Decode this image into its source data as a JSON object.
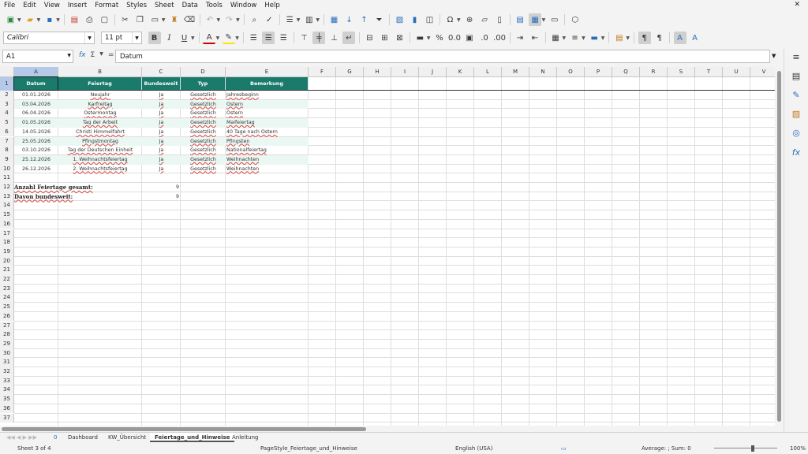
{
  "menu": [
    "File",
    "Edit",
    "View",
    "Insert",
    "Format",
    "Styles",
    "Sheet",
    "Data",
    "Tools",
    "Window",
    "Help"
  ],
  "close_glyph": "✕",
  "font": {
    "name": "Calibri",
    "size": "11 pt"
  },
  "formula": {
    "cell_ref": "A1",
    "content": "Datum",
    "sum_glyph": "Σ",
    "fx_glyph": "fx",
    "eq_glyph": "="
  },
  "columns": [
    "A",
    "B",
    "C",
    "D",
    "E",
    "F",
    "G",
    "H",
    "I",
    "J",
    "K",
    "L",
    "M",
    "N",
    "O",
    "P",
    "Q",
    "R",
    "S",
    "T",
    "U",
    "V"
  ],
  "rows": [
    "1",
    "2",
    "3",
    "4",
    "5",
    "6",
    "7",
    "8",
    "9",
    "10",
    "11",
    "12",
    "13",
    "14",
    "15",
    "16",
    "17",
    "18",
    "19",
    "20",
    "21",
    "22",
    "23",
    "24",
    "25",
    "26",
    "27",
    "28",
    "29",
    "30",
    "31",
    "32",
    "33",
    "34",
    "35",
    "36",
    "37"
  ],
  "table": {
    "headers": [
      "Datum",
      "Feiertag",
      "Bundesweit",
      "Typ",
      "Bemerkung"
    ],
    "rows": [
      [
        "01.01.2026",
        "Neujahr",
        "Ja",
        "Gesetzlich",
        "Jahresbeginn"
      ],
      [
        "03.04.2026",
        "Karfreitag",
        "Ja",
        "Gesetzlich",
        "Ostern"
      ],
      [
        "06.04.2026",
        "Ostermontag",
        "Ja",
        "Gesetzlich",
        "Ostern"
      ],
      [
        "01.05.2026",
        "Tag der Arbeit",
        "Ja",
        "Gesetzlich",
        "Maifeiertag"
      ],
      [
        "14.05.2026",
        "Christi Himmelfahrt",
        "Ja",
        "Gesetzlich",
        "40 Tage nach Ostern"
      ],
      [
        "25.05.2026",
        "Pfingstmontag",
        "Ja",
        "Gesetzlich",
        "Pfingsten"
      ],
      [
        "03.10.2026",
        "Tag der Deutschen Einheit",
        "Ja",
        "Gesetzlich",
        "Nationalfeiertag"
      ],
      [
        "25.12.2026",
        "1. Weihnachtsfeiertag",
        "Ja",
        "Gesetzlich",
        "Weihnachten"
      ],
      [
        "26.12.2026",
        "2. Weihnachtsfeiertag",
        "Ja",
        "Gesetzlich",
        "Weihnachten"
      ]
    ]
  },
  "summary": [
    {
      "label": "Anzahl Feiertage gesamt:",
      "value": "9"
    },
    {
      "label": "Davon bundesweit:",
      "value": "9"
    }
  ],
  "sheet_tabs": [
    "Dashboard",
    "KW_Übersicht",
    "Feiertage_und_Hinweise",
    "Anleitung"
  ],
  "active_tab": "Feiertage_und_Hinweise",
  "tab_add_label": "0",
  "status": {
    "sheet": "Sheet 3 of 4",
    "page_style": "PageStyle_Feiertage_und_Hinweise",
    "language": "English (USA)",
    "sum": "Average: ; Sum: 0",
    "zoom": "100%"
  },
  "colors": {
    "header_bg": "#1a7a6b",
    "band_bg": "#eaf7f2",
    "selection": "#b5c9e8"
  }
}
